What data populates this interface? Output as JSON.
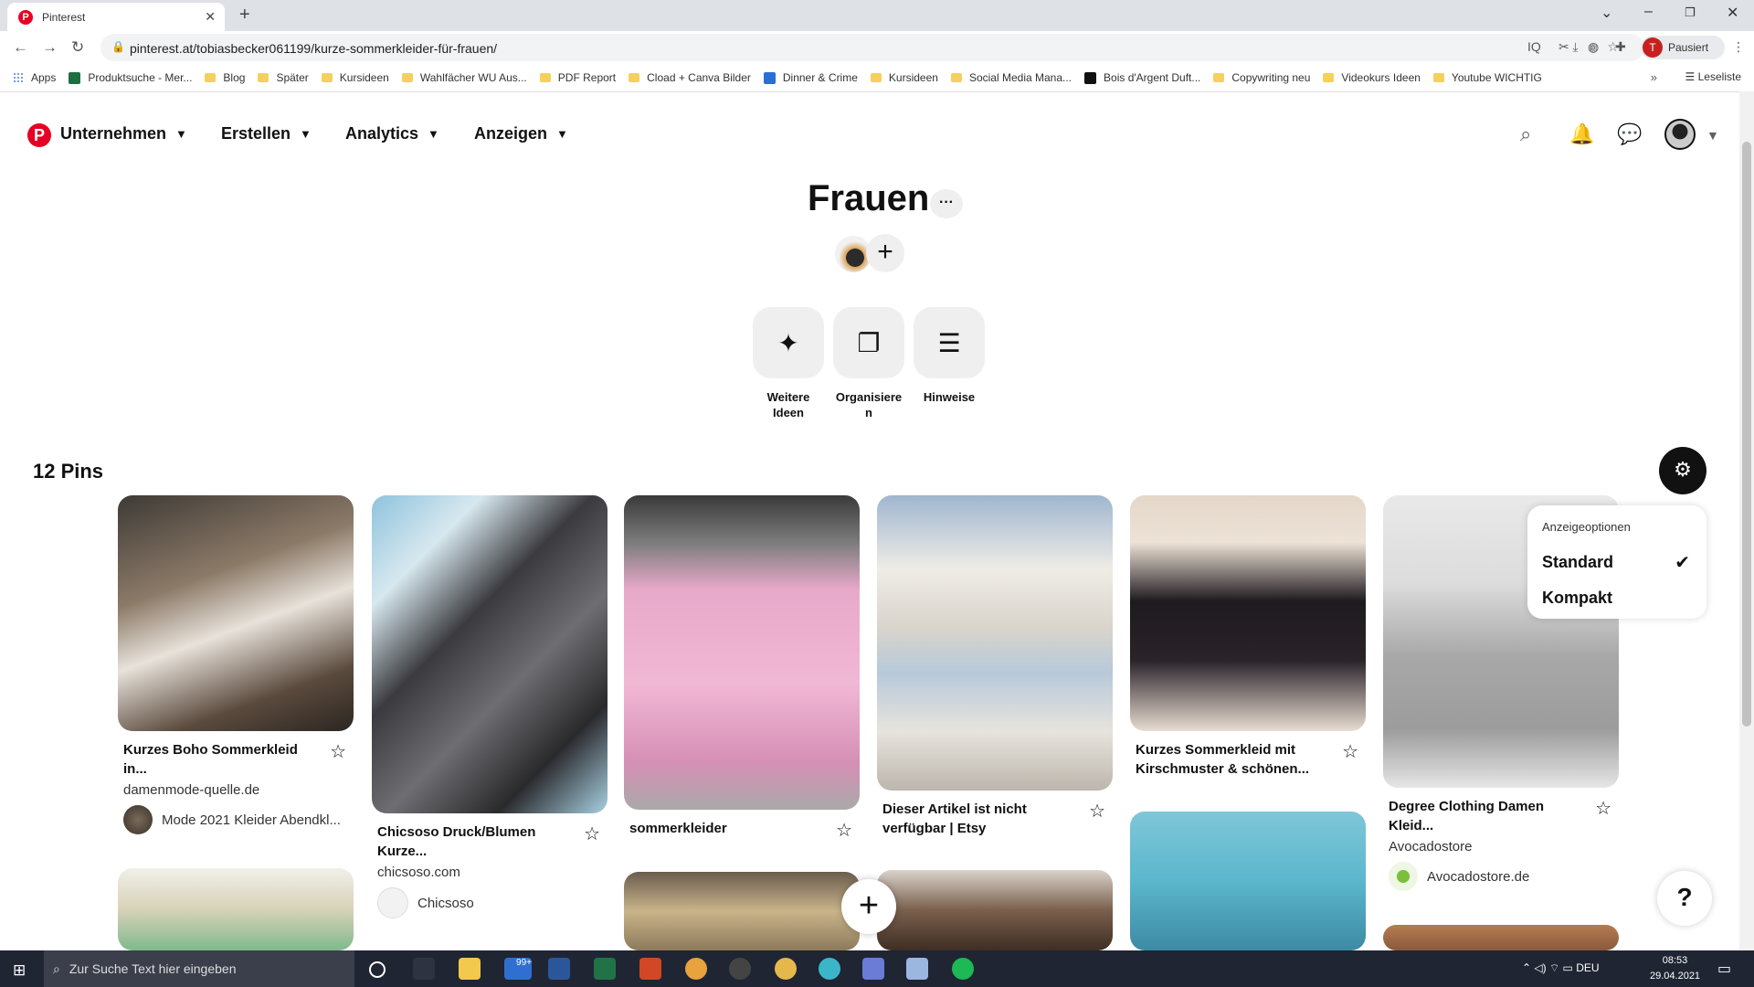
{
  "browser": {
    "tab_title": "Pinterest",
    "url": "pinterest.at/tobiasbecker061199/kurze-sommerkleider-für-frauen/",
    "profile_initial": "T",
    "profile_label": "Pausiert",
    "bookmarks": [
      "Apps",
      "Produktsuche - Mer...",
      "Blog",
      "Später",
      "Kursideen",
      "Wahlfächer WU Aus...",
      "PDF Report",
      "Cload + Canva Bilder",
      "Dinner & Crime",
      "Kursideen",
      "Social Media Mana...",
      "Bois d'Argent Duft...",
      "Copywriting neu",
      "Videokurs Ideen",
      "Youtube WICHTIG"
    ],
    "reading_list": "Leseliste"
  },
  "header": {
    "nav": [
      "Unternehmen",
      "Erstellen",
      "Analytics",
      "Anzeigen"
    ]
  },
  "board": {
    "title": "Frauen",
    "more": "···",
    "add": "+",
    "actions": [
      {
        "label": "Weitere Ideen",
        "icon": "sparkle-icon"
      },
      {
        "label": "Organisieren",
        "icon": "organize-icon"
      },
      {
        "label": "Hinweise",
        "icon": "notes-icon"
      }
    ],
    "pin_count": "12 Pins"
  },
  "pins": [
    {
      "title": "Kurzes Boho Sommerkleid in...",
      "source": "damenmode-quelle.de",
      "attribution": "Mode 2021 Kleider Abendkl..."
    },
    {
      "title": "Chicsoso Druck/Blumen Kurze...",
      "source": "chicsoso.com",
      "attribution": "Chicsoso"
    },
    {
      "title": "sommerkleider"
    },
    {
      "title": "Dieser Artikel ist nicht verfügbar | Etsy"
    },
    {
      "title": "Kurzes Sommerkleid mit Kirschmuster & schönen..."
    },
    {
      "title": "Degree Clothing Damen Kleid...",
      "source": "Avocadostore",
      "attribution": "Avocadostore.de"
    }
  ],
  "dropdown": {
    "header": "Anzeigeoptionen",
    "options": [
      "Standard",
      "Kompakt"
    ],
    "selected": "Standard"
  },
  "help": "?",
  "taskbar": {
    "search_placeholder": "Zur Suche Text hier eingeben",
    "badge": "99+",
    "lang": "DEU",
    "time": "08:53",
    "date": "29.04.2021"
  }
}
